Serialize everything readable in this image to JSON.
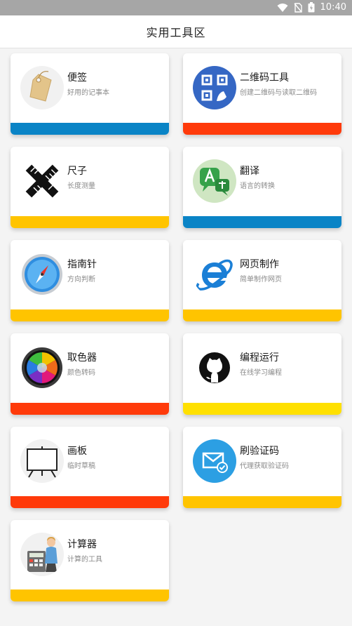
{
  "status": {
    "time": "10:40"
  },
  "header": {
    "title": "实用工具区"
  },
  "tools": [
    {
      "name": "便签",
      "desc": "好用的记事本",
      "icon": "price-tag-icon",
      "bar_color": "#0a84c6"
    },
    {
      "name": "二维码工具",
      "desc": "创建二维码与读取二维码",
      "icon": "qr-code-icon",
      "bar_color": "#ff3a0a"
    },
    {
      "name": "尺子",
      "desc": "长度测量",
      "icon": "ruler-icon",
      "bar_color": "#ffc400"
    },
    {
      "name": "翻译",
      "desc": "语言的转换",
      "icon": "translate-icon",
      "bar_color": "#0a84c6"
    },
    {
      "name": "指南针",
      "desc": "方向判断",
      "icon": "compass-icon",
      "bar_color": "#ffc400"
    },
    {
      "name": "网页制作",
      "desc": "简单制作网页",
      "icon": "internet-explorer-icon",
      "bar_color": "#ffc400"
    },
    {
      "name": "取色器",
      "desc": "颜色转码",
      "icon": "color-picker-icon",
      "bar_color": "#ff3a0a"
    },
    {
      "name": "编程运行",
      "desc": "在线学习编程",
      "icon": "github-icon",
      "bar_color": "#ffe000"
    },
    {
      "name": "画板",
      "desc": "临时草稿",
      "icon": "easel-icon",
      "bar_color": "#ff3a0a"
    },
    {
      "name": "刷验证码",
      "desc": "代理获取验证码",
      "icon": "mail-check-icon",
      "bar_color": "#ffc400"
    },
    {
      "name": "计算器",
      "desc": "计算的工具",
      "icon": "calculator-icon",
      "bar_color": "#ffc400"
    }
  ]
}
